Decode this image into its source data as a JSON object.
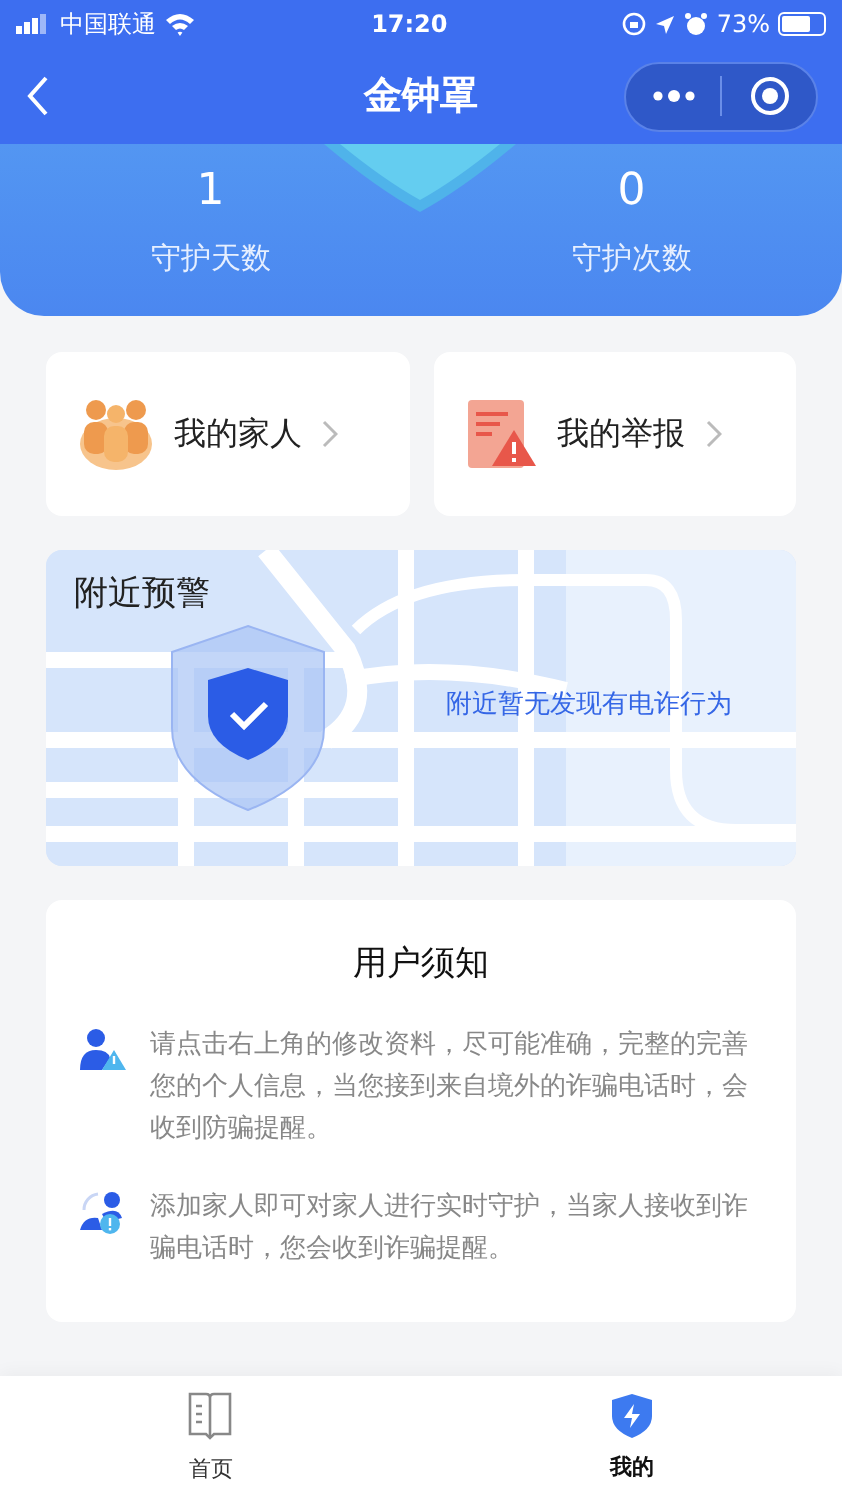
{
  "status_bar": {
    "carrier": "中国联通",
    "time": "17:20",
    "battery": "73%"
  },
  "nav": {
    "title": "金钟罩"
  },
  "stats": [
    {
      "value": "1",
      "label": "守护天数"
    },
    {
      "value": "0",
      "label": "守护次数"
    }
  ],
  "shortcuts": [
    {
      "kind": "family",
      "label": "我的家人"
    },
    {
      "kind": "report",
      "label": "我的举报"
    }
  ],
  "nearby": {
    "title": "附近预警",
    "message": "附近暂无发现有电诈行为"
  },
  "notice": {
    "title": "用户须知",
    "items": [
      {
        "kind": "person",
        "text": "请点击右上角的修改资料，尽可能准确，完整的完善您的个人信息，当您接到来自境外的诈骗电话时，会收到防骗提醒。"
      },
      {
        "kind": "family",
        "text": "添加家人即可对家人进行实时守护，当家人接收到诈骗电话时，您会收到诈骗提醒。"
      }
    ]
  },
  "tabs": [
    {
      "kind": "home",
      "label": "首页",
      "selected": false
    },
    {
      "kind": "mine",
      "label": "我的",
      "selected": true
    }
  ]
}
